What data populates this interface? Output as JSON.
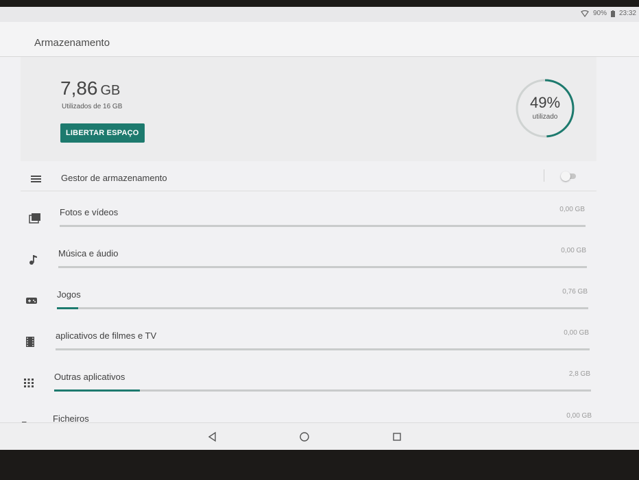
{
  "status": {
    "battery": "90%",
    "time": "23:32"
  },
  "app": {
    "title": "Armazenamento"
  },
  "summary": {
    "used_value": "7,86",
    "used_unit": "GB",
    "used_of": "Utilizados de 16 GB",
    "free_button": "LIBERTAR ESPAÇO",
    "percent": "49%",
    "percent_label": "utilizado",
    "percent_fraction": 0.49
  },
  "manager": {
    "label": "Gestor de armazenamento",
    "enabled": false
  },
  "categories": [
    {
      "label": "Fotos e vídeos",
      "size": "0,00 GB",
      "fraction": 0.0,
      "icon": "photo-library-icon"
    },
    {
      "label": "Música e áudio",
      "size": "0,00 GB",
      "fraction": 0.0,
      "icon": "music-note-icon"
    },
    {
      "label": "Jogos",
      "size": "0,76 GB",
      "fraction": 0.04,
      "icon": "gamepad-icon"
    },
    {
      "label": "aplicativos de filmes e TV",
      "size": "0,00 GB",
      "fraction": 0.0,
      "icon": "film-icon"
    },
    {
      "label": "Outras aplicativos",
      "size": "2,8 GB",
      "fraction": 0.16,
      "icon": "apps-grid-icon"
    },
    {
      "label": "Ficheiros",
      "size": "0,00 GB",
      "fraction": 0.0,
      "icon": "folder-icon"
    }
  ],
  "colors": {
    "accent": "#1d7a6e",
    "track": "#c9cbcb"
  }
}
